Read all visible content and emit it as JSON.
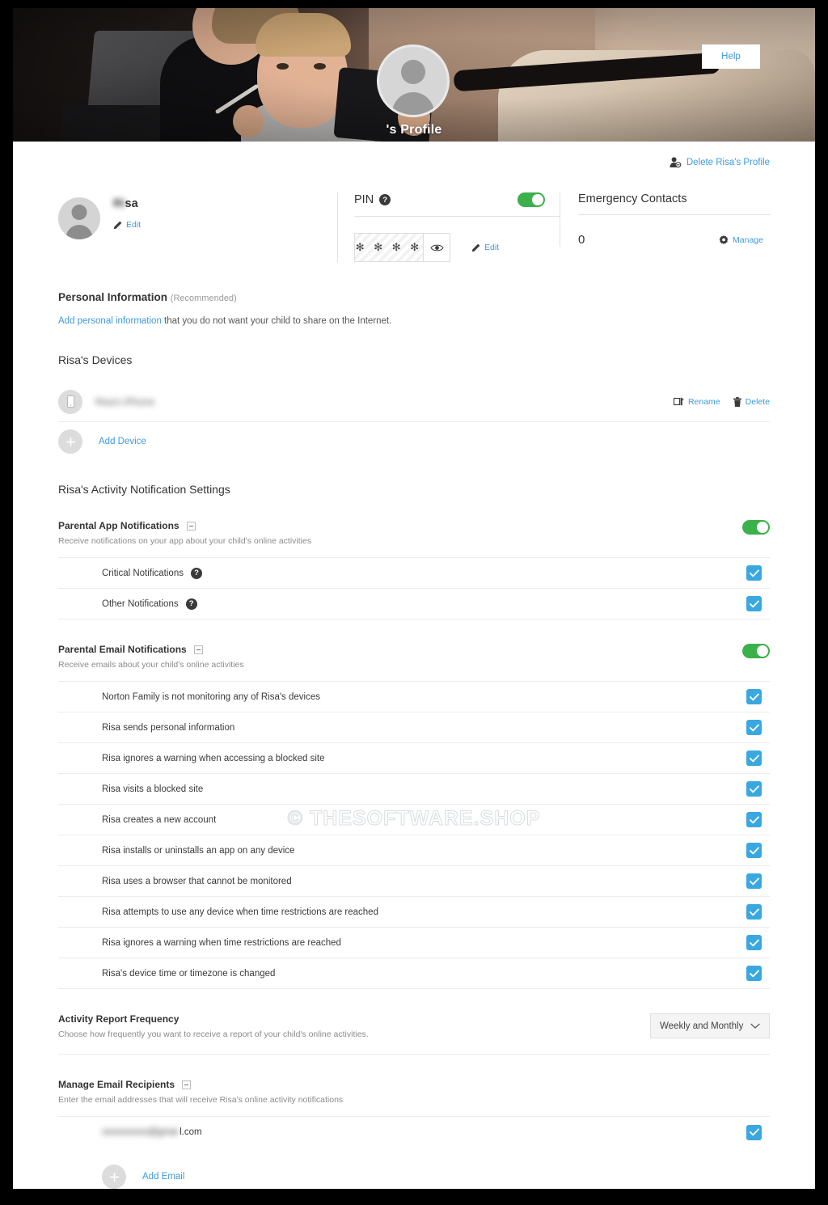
{
  "header": {
    "profile_title": "'s Profile",
    "help_label": "Help",
    "avatar_icon": "person-avatar-icon"
  },
  "top": {
    "delete_profile_label": "Delete Risa's Profile",
    "delete_profile_icon": "person-remove-icon",
    "child_name": "Risa",
    "child_name_blurred_prefix": "Ri",
    "child_name_visible_suffix": "sa",
    "edit_label": "Edit",
    "edit_icon": "pencil-icon",
    "pin": {
      "label": "PIN",
      "help_icon": "question-mark-icon",
      "toggle_on": true,
      "masked_value": "✻ ✻ ✻ ✻",
      "reveal_icon": "eye-icon",
      "edit_label": "Edit",
      "edit_icon": "pencil-icon"
    },
    "emergency_contacts": {
      "title": "Emergency Contacts",
      "count": "0",
      "manage_label": "Manage",
      "manage_icon": "gear-icon"
    }
  },
  "personal_information": {
    "title": "Personal Information",
    "recommended_tag": "(Recommended)",
    "link_text": "Add personal information",
    "rest_text": " that you do not want your child to share on the Internet."
  },
  "devices": {
    "title": "Risa's Devices",
    "rows": [
      {
        "name": "Risa's iPhone",
        "icon": "mobile-device-icon",
        "rename_label": "Rename",
        "rename_icon": "tag-icon",
        "delete_label": "Delete",
        "delete_icon": "trash-icon"
      }
    ],
    "add_label": "Add Device",
    "add_icon": "plus-icon"
  },
  "activity_settings": {
    "title": "Risa's Activity Notification Settings",
    "app_notifications": {
      "title": "Parental App Notifications",
      "collapse_icon": "minus-square-icon",
      "description": "Receive notifications on your app about your child's online activities",
      "toggle_on": true,
      "options": [
        {
          "label": "Critical Notifications",
          "help_icon": "question-mark-icon",
          "checked": true
        },
        {
          "label": "Other Notifications",
          "help_icon": "question-mark-icon",
          "checked": true
        }
      ]
    },
    "email_notifications": {
      "title": "Parental Email Notifications",
      "collapse_icon": "minus-square-icon",
      "description": "Receive emails about your child's online activities",
      "toggle_on": true,
      "options": [
        {
          "label": "Norton Family is not monitoring any of Risa's devices",
          "checked": true
        },
        {
          "label": "Risa sends personal information",
          "checked": true
        },
        {
          "label": "Risa ignores a warning when accessing a blocked site",
          "checked": true
        },
        {
          "label": "Risa visits a blocked site",
          "checked": true
        },
        {
          "label": "Risa creates a new account",
          "checked": true
        },
        {
          "label": "Risa installs or uninstalls an app on any device",
          "checked": true
        },
        {
          "label": "Risa uses a browser that cannot be monitored",
          "checked": true
        },
        {
          "label": "Risa attempts to use any device when time restrictions are reached",
          "checked": true
        },
        {
          "label": "Risa ignores a warning when time restrictions are reached",
          "checked": true
        },
        {
          "label": "Risa's device time or timezone is changed",
          "checked": true
        }
      ]
    },
    "report_frequency": {
      "title": "Activity Report Frequency",
      "description": "Choose how frequently you want to receive a report of your child's online activities.",
      "selected": "Weekly and Monthly",
      "chevron_icon": "chevron-down-icon"
    },
    "email_recipients": {
      "title": "Manage Email Recipients",
      "collapse_icon": "minus-square-icon",
      "description": "Enter the email addresses that will receive Risa's online activity notifications",
      "rows": [
        {
          "email_blurred": "xxxxxxxxxx@gmai",
          "email_visible": "l.com",
          "checked": true
        }
      ],
      "add_label": "Add Email",
      "add_icon": "plus-icon"
    }
  },
  "watermark": {
    "text": "© THESOFTWARE.SHOP"
  },
  "colors": {
    "accent_blue": "#3d9ae0",
    "toggle_green": "#3cb04a",
    "checkbox_blue": "#3aa8e0"
  }
}
